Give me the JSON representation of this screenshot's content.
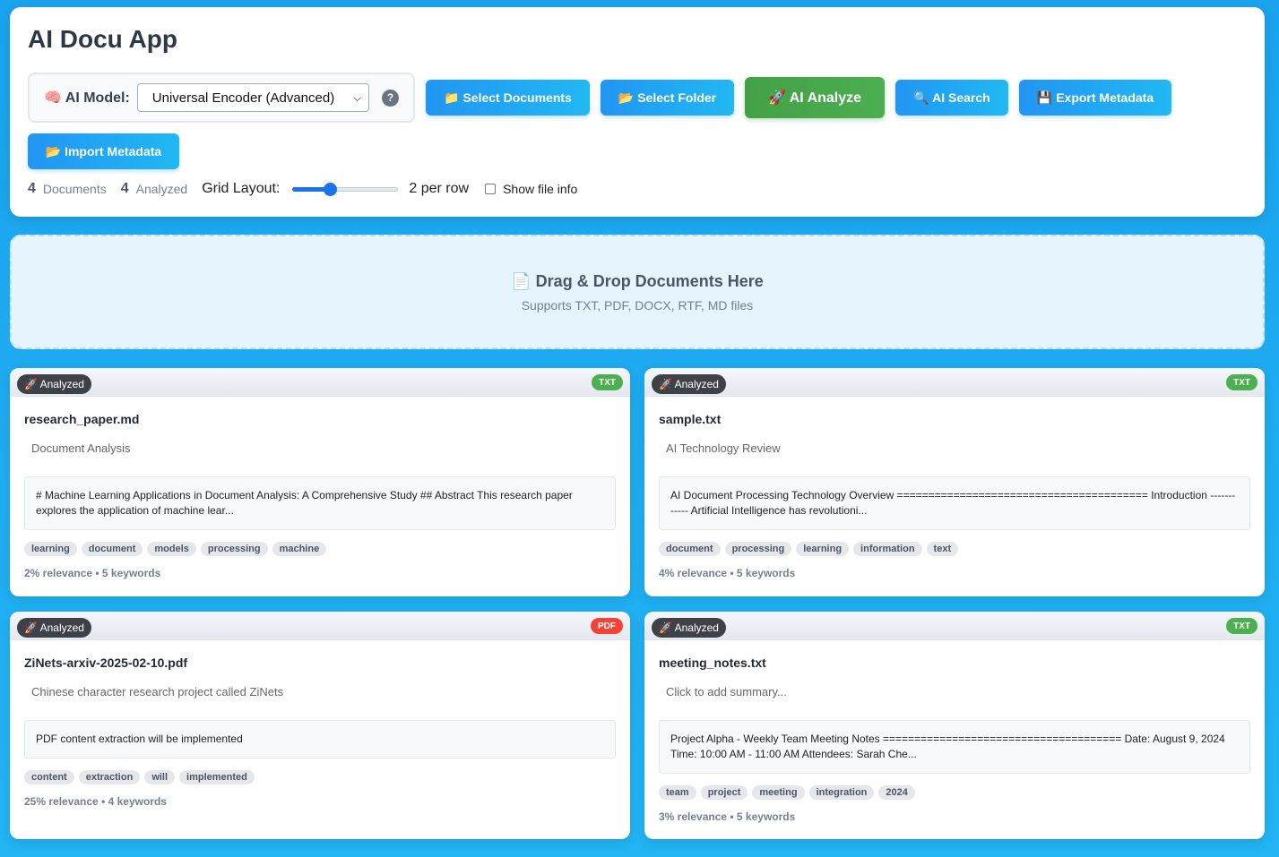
{
  "app": {
    "title": "AI Docu App"
  },
  "model": {
    "label": "🧠 AI Model:",
    "selected": "Universal Encoder (Advanced)",
    "help": "?"
  },
  "toolbar": {
    "select_documents": "📁 Select Documents",
    "select_folder": "📂 Select Folder",
    "ai_analyze": "🚀 AI Analyze",
    "ai_search": "🔍 AI Search",
    "export_metadata": "💾 Export Metadata",
    "import_metadata": "📂 Import Metadata"
  },
  "stats": {
    "documents_count": "4",
    "documents_label": "Documents",
    "analyzed_count": "4",
    "analyzed_label": "Analyzed",
    "grid_label": "Grid Layout:",
    "per_row": "2 per row",
    "show_file_info": "Show file info",
    "grid_slider_fraction": 0.35
  },
  "dropzone": {
    "title": "📄 Drag & Drop Documents Here",
    "subtitle": "Supports TXT, PDF, DOCX, RTF, MD files"
  },
  "colors": {
    "txt": "#4caf50",
    "pdf": "#f44336",
    "accent": "#2196f3"
  },
  "cards": [
    {
      "status": "🚀 Analyzed",
      "type": "TXT",
      "filename": "research_paper.md",
      "summary": "Document Analysis",
      "preview": "# Machine Learning Applications in Document Analysis: A Comprehensive Study ## Abstract This research paper explores the application of machine lear...",
      "tags": [
        "learning",
        "document",
        "models",
        "processing",
        "machine"
      ],
      "meta": "2% relevance • 5 keywords"
    },
    {
      "status": "🚀 Analyzed",
      "type": "TXT",
      "filename": "sample.txt",
      "summary": "AI Technology Review",
      "preview": "AI Document Processing Technology Overview ======================================== Introduction ------------ Artificial Intelligence has revolutioni...",
      "tags": [
        "document",
        "processing",
        "learning",
        "information",
        "text"
      ],
      "meta": "4% relevance • 5 keywords"
    },
    {
      "status": "🚀 Analyzed",
      "type": "PDF",
      "filename": "ZiNets-arxiv-2025-02-10.pdf",
      "summary": "Chinese character research project called ZiNets",
      "preview": "PDF content extraction will be implemented",
      "tags": [
        "content",
        "extraction",
        "will",
        "implemented"
      ],
      "meta": "25% relevance • 4 keywords"
    },
    {
      "status": "🚀 Analyzed",
      "type": "TXT",
      "filename": "meeting_notes.txt",
      "summary": "Click to add summary...",
      "preview": "Project Alpha - Weekly Team Meeting Notes ====================================== Date: August 9, 2024 Time: 10:00 AM - 11:00 AM Attendees: Sarah Che...",
      "tags": [
        "team",
        "project",
        "meeting",
        "integration",
        "2024"
      ],
      "meta": "3% relevance • 5 keywords"
    }
  ]
}
